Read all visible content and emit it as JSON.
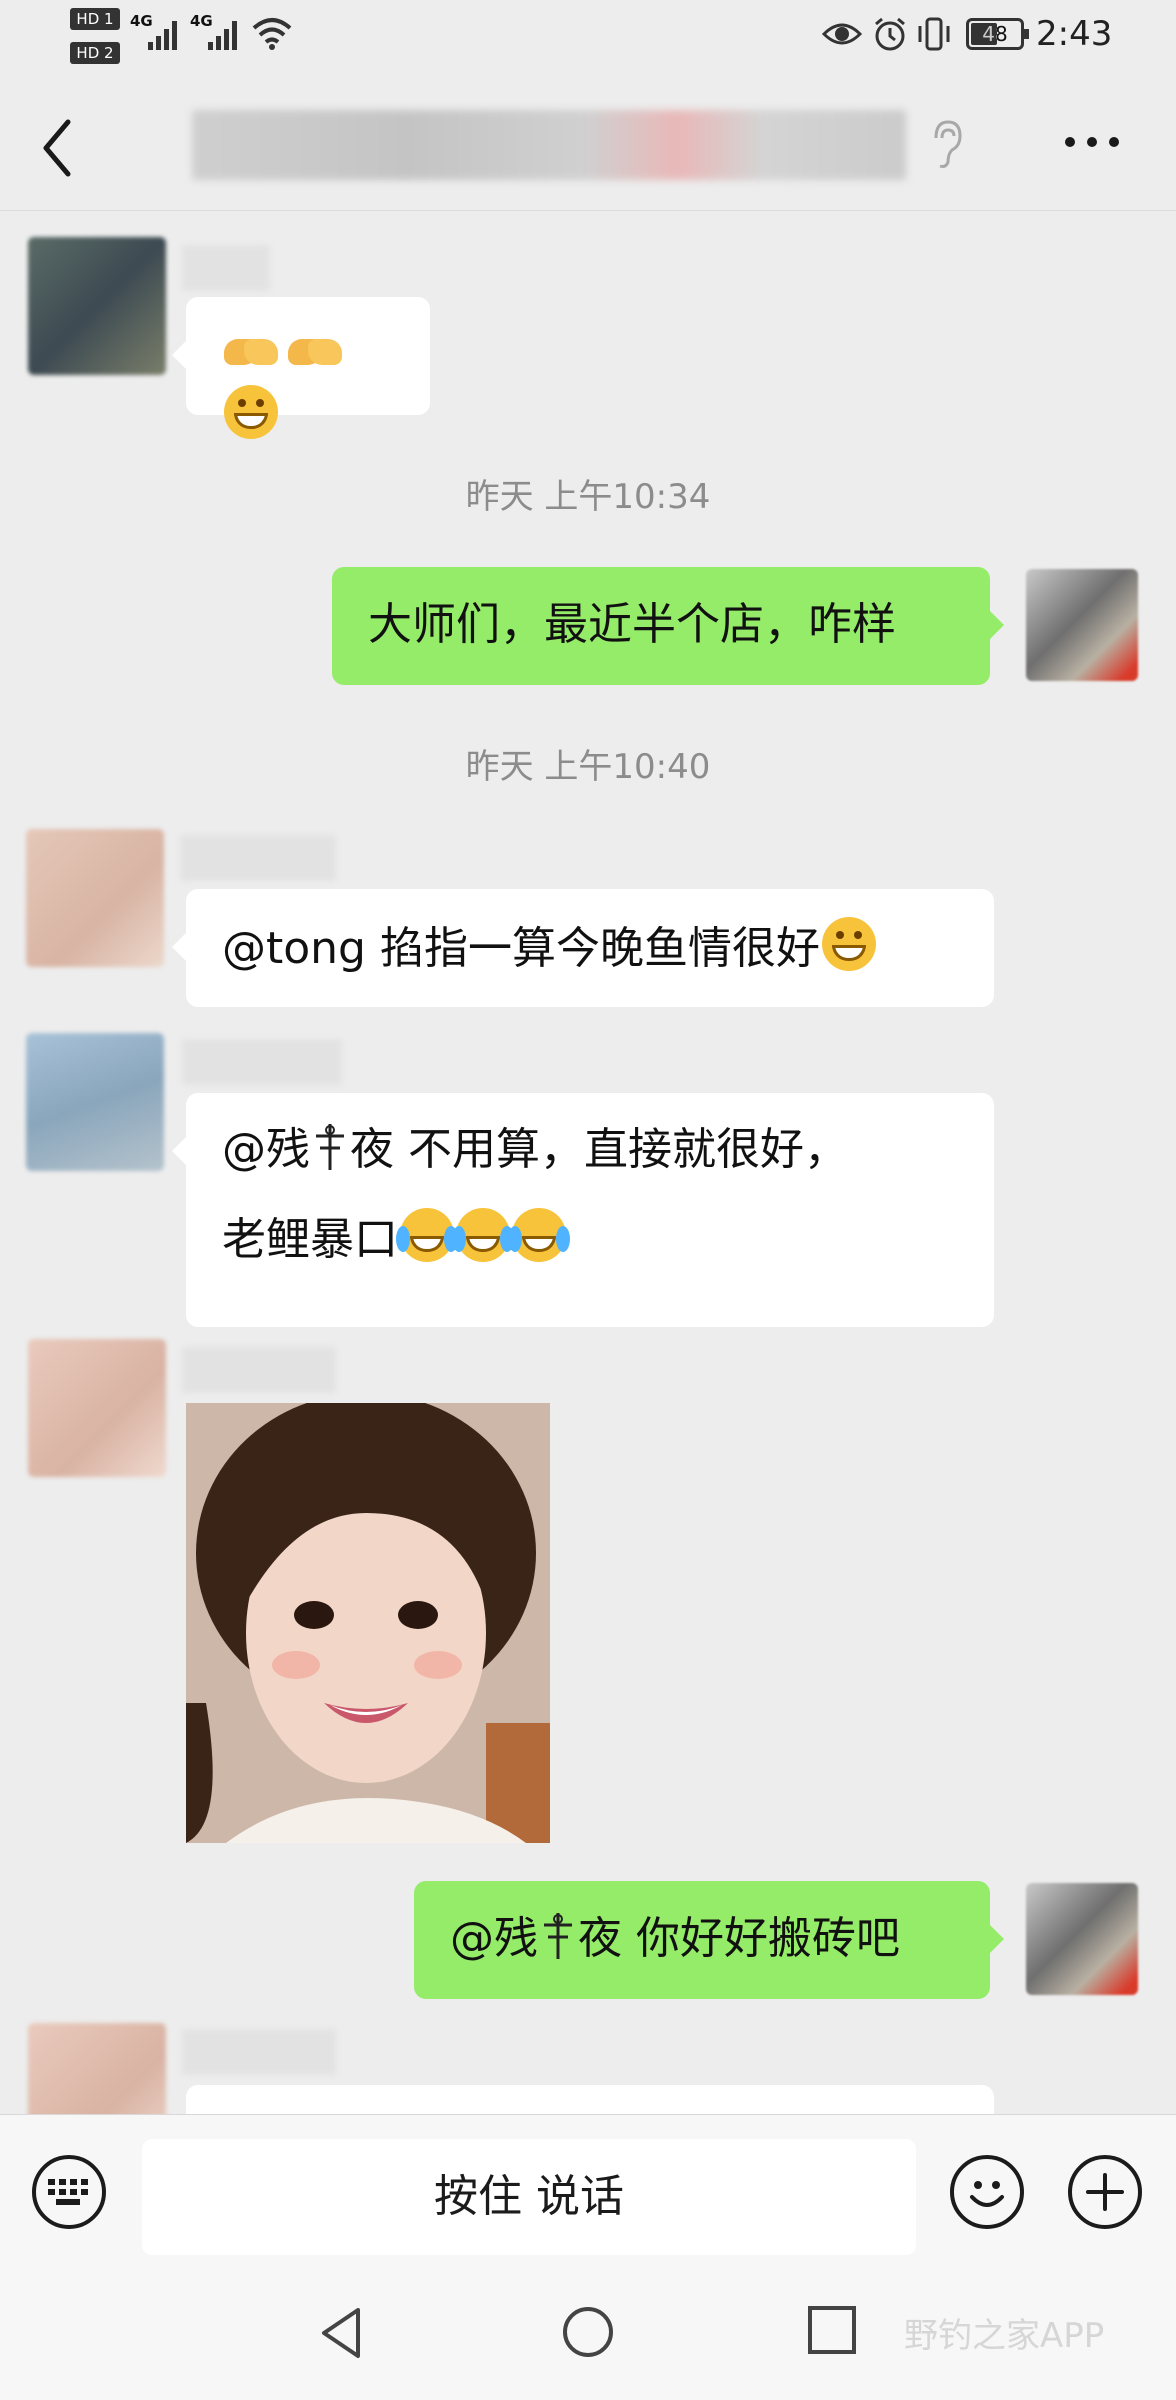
{
  "status_bar": {
    "hd1": "HD 1",
    "hd2": "HD 2",
    "net1": "4G",
    "net2": "4G",
    "battery": "48",
    "time": "2:43"
  },
  "header": {
    "back_icon": "chevron-left-icon",
    "title": "",
    "ear_icon": "ear-icon",
    "more_icon": "more-icon"
  },
  "messages": [
    {
      "type": "emoji",
      "side": "left"
    },
    {
      "type": "timestamp",
      "text": "昨天 上午10:34"
    },
    {
      "type": "text",
      "side": "right",
      "text": "大师们，最近半个店，咋样"
    },
    {
      "type": "timestamp",
      "text": "昨天 上午10:40"
    },
    {
      "type": "text",
      "side": "left",
      "text": "@tong  掐指一算今晚鱼情很好"
    },
    {
      "type": "text",
      "side": "left",
      "line1": "@残",
      "line1b": "夜 不用算，直接就很好，",
      "line2": "老鲤暴口"
    },
    {
      "type": "image",
      "side": "left"
    },
    {
      "type": "text",
      "side": "right",
      "prefix": "@残",
      "text": "夜 你好好搬砖吧"
    }
  ],
  "input_bar": {
    "voice_label": "按住 说话",
    "keyboard_icon": "keyboard-icon",
    "emoji_icon": "smiley-icon",
    "plus_icon": "plus-icon"
  },
  "nav_bar": {
    "back_icon": "triangle-back-icon",
    "home_icon": "circle-home-icon",
    "recent_icon": "square-recent-icon",
    "watermark": "野钓之家APP"
  }
}
